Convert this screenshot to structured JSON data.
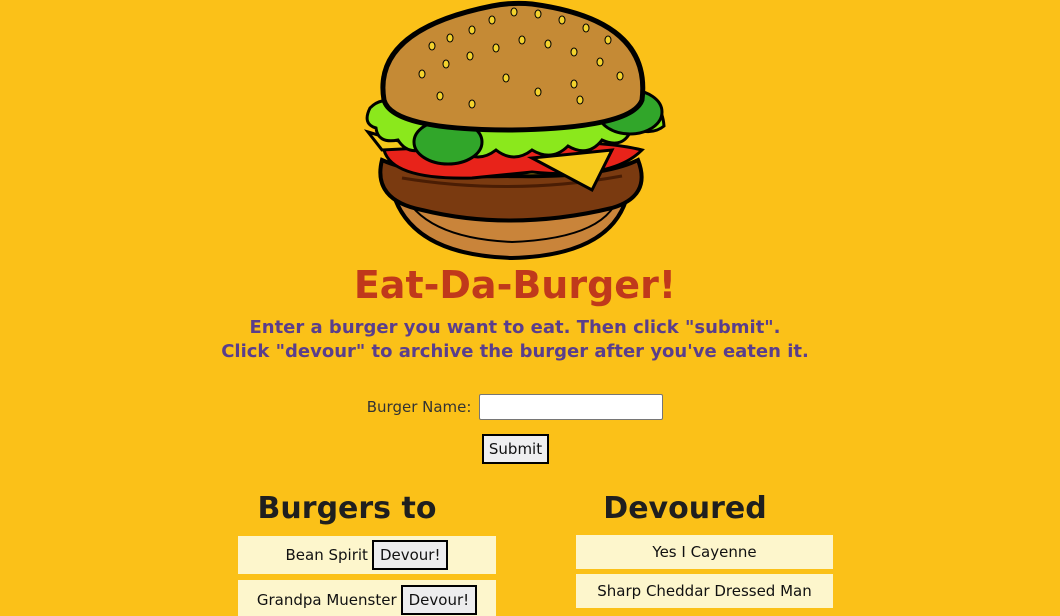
{
  "header": {
    "title": "Eat-Da-Burger!",
    "instructions_line1": "Enter a burger you want to eat. Then click \"submit\".",
    "instructions_line2": "Click \"devour\" to archive the burger after you've eaten it."
  },
  "form": {
    "label": "Burger Name:",
    "value": "",
    "submit_label": "Submit"
  },
  "to_devour": {
    "heading": "Burgers to devour!",
    "items": [
      {
        "name": "Bean Spirit",
        "button": "Devour!"
      },
      {
        "name": "Grandpa Muenster",
        "button": "Devour!"
      }
    ]
  },
  "devoured": {
    "heading": "Devoured burgers!",
    "items": [
      {
        "name": "Yes I Cayenne"
      },
      {
        "name": "Sharp Cheddar Dressed Man"
      }
    ]
  },
  "colors": {
    "background": "#fbc118",
    "title": "#c0391b",
    "instructions": "#5a3e8c",
    "item_bg": "#fdf6cc"
  },
  "icons": {
    "logo": "burger-icon"
  }
}
